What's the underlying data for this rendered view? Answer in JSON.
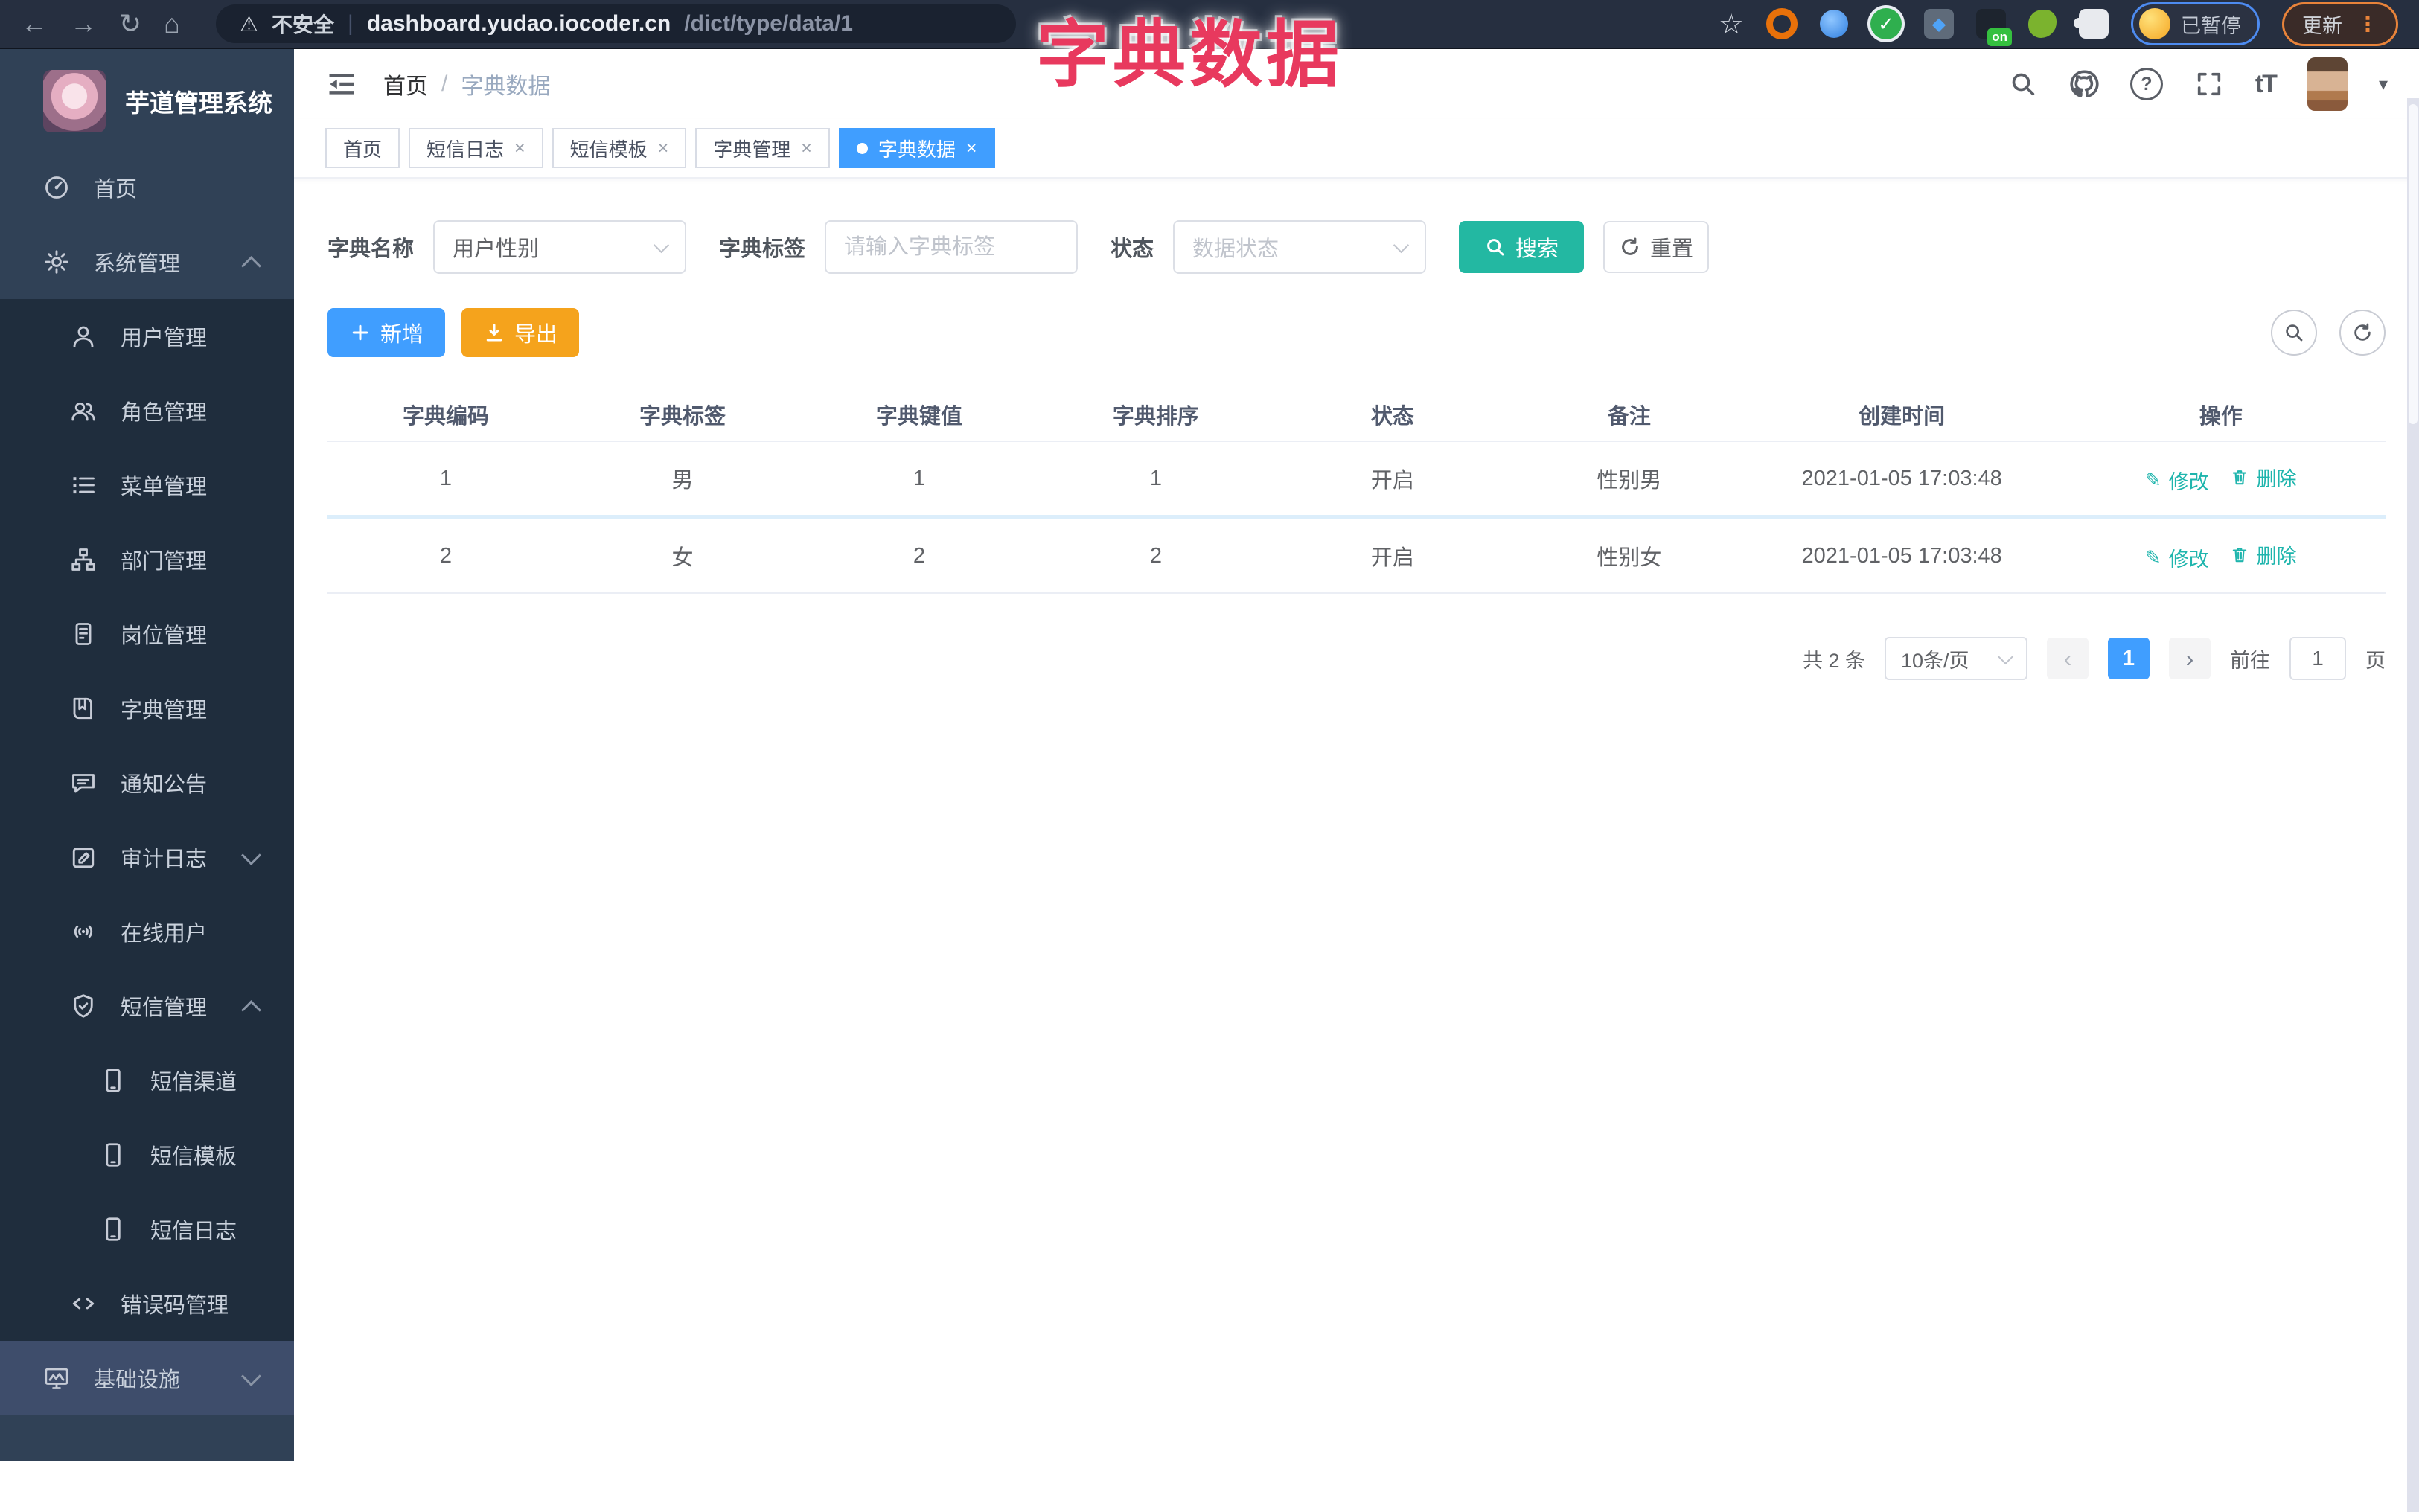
{
  "annotation": {
    "text": "字典数据"
  },
  "icons": {
    "back": "←",
    "forward": "→",
    "reload": "↻",
    "home": "⌂",
    "warning": "⚠",
    "divider": "|",
    "star": "☆",
    "dots": "⋮",
    "diamond": "◆",
    "check": "✓",
    "help": "?",
    "font_size": "tT",
    "caret": "▾",
    "prev": "‹",
    "next": "›",
    "pencil": "✎",
    "plus": "+"
  },
  "browser": {
    "security_label": "不安全",
    "url_host": "dashboard.yudao.iocoder.cn",
    "url_path": "/dict/type/data/1",
    "on_badge": "on",
    "profile_status": "已暂停",
    "update_label": "更新"
  },
  "sidebar": {
    "logo_title": "芋道管理系统",
    "items": [
      {
        "label": "首页"
      },
      {
        "label": "系统管理"
      },
      {
        "label": "用户管理"
      },
      {
        "label": "角色管理"
      },
      {
        "label": "菜单管理"
      },
      {
        "label": "部门管理"
      },
      {
        "label": "岗位管理"
      },
      {
        "label": "字典管理"
      },
      {
        "label": "通知公告"
      },
      {
        "label": "审计日志"
      },
      {
        "label": "在线用户"
      },
      {
        "label": "短信管理"
      },
      {
        "label": "短信渠道"
      },
      {
        "label": "短信模板"
      },
      {
        "label": "短信日志"
      },
      {
        "label": "错误码管理"
      },
      {
        "label": "基础设施"
      }
    ]
  },
  "header": {
    "breadcrumb": {
      "home": "首页",
      "separator": "/",
      "current": "字典数据"
    }
  },
  "tabs": {
    "close_glyph": "×",
    "items": [
      {
        "label": "首页"
      },
      {
        "label": "短信日志"
      },
      {
        "label": "短信模板"
      },
      {
        "label": "字典管理"
      },
      {
        "label": "字典数据"
      }
    ]
  },
  "filters": {
    "dict_name_label": "字典名称",
    "dict_name_value": "用户性别",
    "dict_label_label": "字典标签",
    "dict_label_placeholder": "请输入字典标签",
    "status_label": "状态",
    "status_placeholder": "数据状态",
    "search_label": "搜索",
    "reset_label": "重置"
  },
  "toolbar": {
    "add_label": "新增",
    "export_label": "导出"
  },
  "table": {
    "columns": [
      "字典编码",
      "字典标签",
      "字典键值",
      "字典排序",
      "状态",
      "备注",
      "创建时间",
      "操作"
    ],
    "actions": {
      "edit": "修改",
      "delete": "删除"
    },
    "rows": [
      {
        "code": "1",
        "label": "男",
        "value": "1",
        "sort": "1",
        "status": "开启",
        "remark": "性别男",
        "created": "2021-01-05 17:03:48"
      },
      {
        "code": "2",
        "label": "女",
        "value": "2",
        "sort": "2",
        "status": "开启",
        "remark": "性别女",
        "created": "2021-01-05 17:03:48"
      }
    ]
  },
  "pagination": {
    "total_text": "共 2 条",
    "page_size_text": "10条/页",
    "current_page": "1",
    "goto_label": "前往",
    "goto_value": "1",
    "unit_label": "页"
  },
  "colors": {
    "primary": "#409eff",
    "teal": "#23b8a2",
    "warning": "#f5a31c",
    "annotation": "#e8395e"
  }
}
